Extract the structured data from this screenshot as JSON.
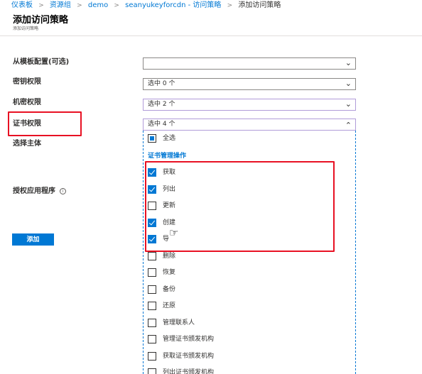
{
  "breadcrumb": {
    "items": [
      "仪表板",
      "资源组",
      "demo",
      "seanyukeyforcdn - 访问策略",
      "添加访问策略"
    ],
    "separator": ">"
  },
  "header": {
    "title": "添加访问策略",
    "subtitle": "添加访问策略"
  },
  "form": {
    "template_label": "从模板配置(可选)",
    "template_value": "",
    "key_perm_label": "密钥权限",
    "key_perm_value": "选中 0 个",
    "secret_perm_label": "机密权限",
    "secret_perm_value": "选中 2 个",
    "cert_perm_label": "证书权限",
    "cert_perm_value": "选中 4 个",
    "principal_label": "选择主体",
    "auth_app_label": "授权应用程序",
    "info_icon": "i",
    "add_button": "添加"
  },
  "dropdown": {
    "select_all": "全选",
    "group_header": "证书管理操作",
    "options": [
      {
        "label": "获取",
        "checked": true
      },
      {
        "label": "列出",
        "checked": true
      },
      {
        "label": "更新",
        "checked": false
      },
      {
        "label": "创建",
        "checked": true
      },
      {
        "label": "导",
        "checked": true
      },
      {
        "label": "删除",
        "checked": false
      },
      {
        "label": "恢复",
        "checked": false
      },
      {
        "label": "备份",
        "checked": false
      },
      {
        "label": "还原",
        "checked": false
      },
      {
        "label": "管理联系人",
        "checked": false
      },
      {
        "label": "管理证书颁发机构",
        "checked": false
      },
      {
        "label": "获取证书颁发机构",
        "checked": false
      },
      {
        "label": "列出证书颁发机构",
        "checked": false
      }
    ]
  },
  "colors": {
    "accent": "#0078d4",
    "highlight": "#e81123"
  }
}
